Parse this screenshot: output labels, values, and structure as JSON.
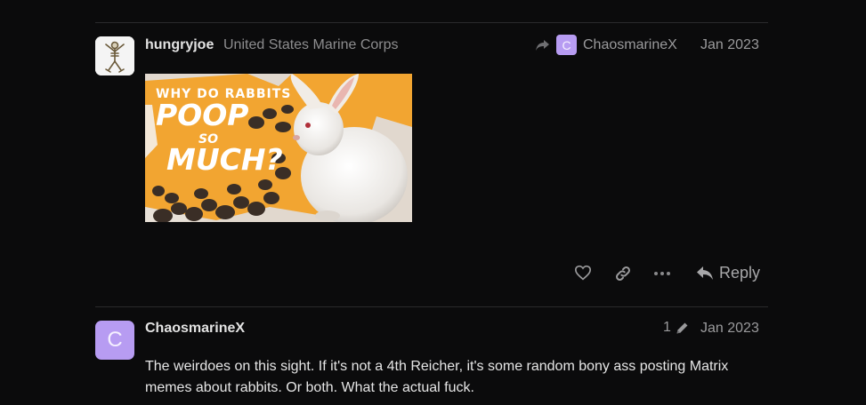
{
  "post1": {
    "username": "hungryjoe",
    "user_title": "United States Marine Corps",
    "reply_to_username": "ChaosmarineX",
    "reply_to_avatar_letter": "C",
    "date": "Jan 2023",
    "image": {
      "line1": "WHY DO RABBITS",
      "line2": "POOP",
      "line3": "SO",
      "line4": "MUCH?",
      "orange": "#f2a531"
    },
    "actions": {
      "like_icon": "heart-icon",
      "link_icon": "link-icon",
      "more_icon": "ellipsis-icon",
      "reply_label": "Reply"
    }
  },
  "post2": {
    "username": "ChaosmarineX",
    "avatar_letter": "C",
    "edit_count": "1",
    "date": "Jan 2023",
    "body": "The weirdoes on this sight. If it's not a 4th Reicher, it's some random bony ass posting Matrix memes about rabbits. Or both. What the actual fuck."
  },
  "colors": {
    "background": "#0b0b0c",
    "avatar_purple": "#b79cf2",
    "muted_text": "#9a9a9c"
  }
}
